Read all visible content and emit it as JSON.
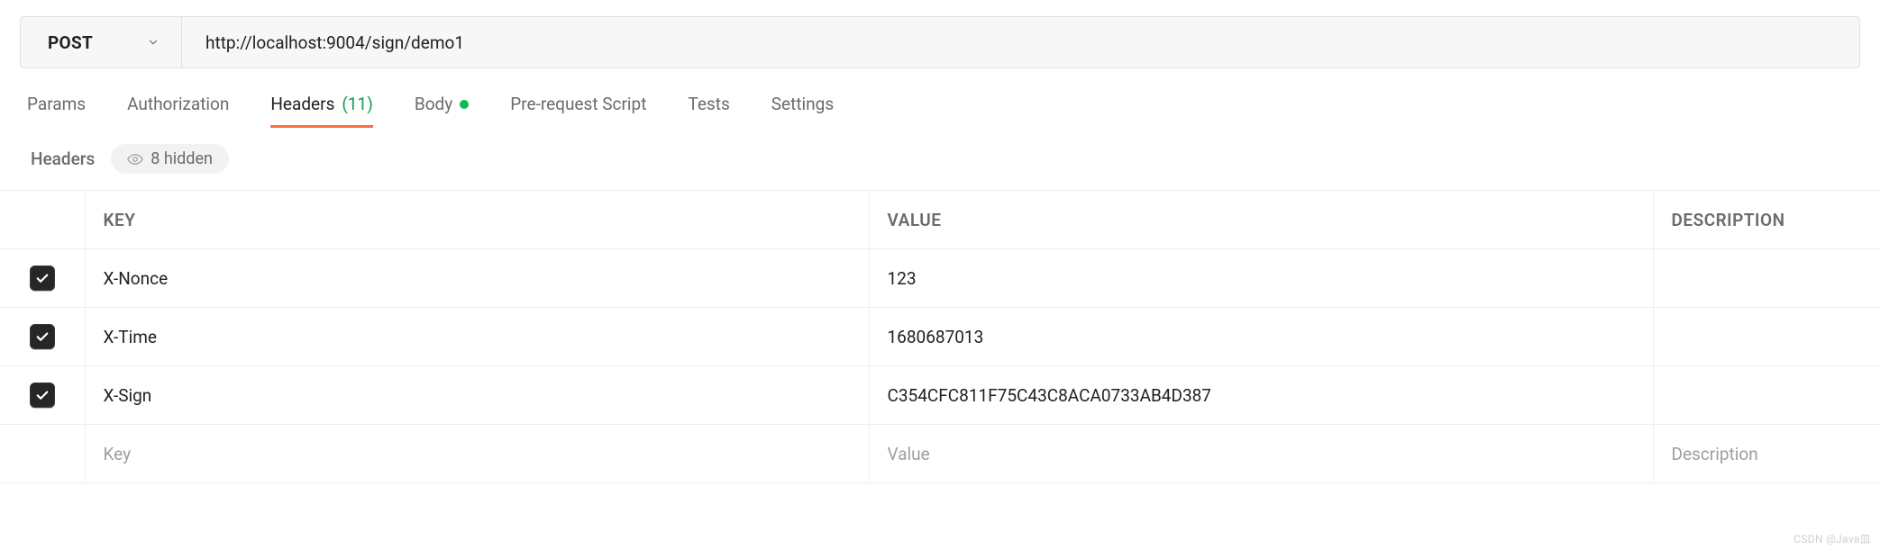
{
  "request": {
    "method": "POST",
    "url": "http://localhost:9004/sign/demo1"
  },
  "tabs": {
    "params": "Params",
    "authorization": "Authorization",
    "headers_label": "Headers",
    "headers_count": "(11)",
    "body": "Body",
    "prerequest": "Pre-request Script",
    "tests": "Tests",
    "settings": "Settings"
  },
  "subheader": {
    "title": "Headers",
    "hidden_label": "8 hidden"
  },
  "columns": {
    "key": "KEY",
    "value": "VALUE",
    "description": "DESCRIPTION"
  },
  "rows": [
    {
      "checked": true,
      "key": "X-Nonce",
      "value": "123",
      "description": ""
    },
    {
      "checked": true,
      "key": "X-Time",
      "value": "1680687013",
      "description": ""
    },
    {
      "checked": true,
      "key": "X-Sign",
      "value": "C354CFC811F75C43C8ACA0733AB4D387",
      "description": ""
    }
  ],
  "placeholders": {
    "key": "Key",
    "value": "Value",
    "description": "Description"
  },
  "watermark": "CSDN @Java皿"
}
